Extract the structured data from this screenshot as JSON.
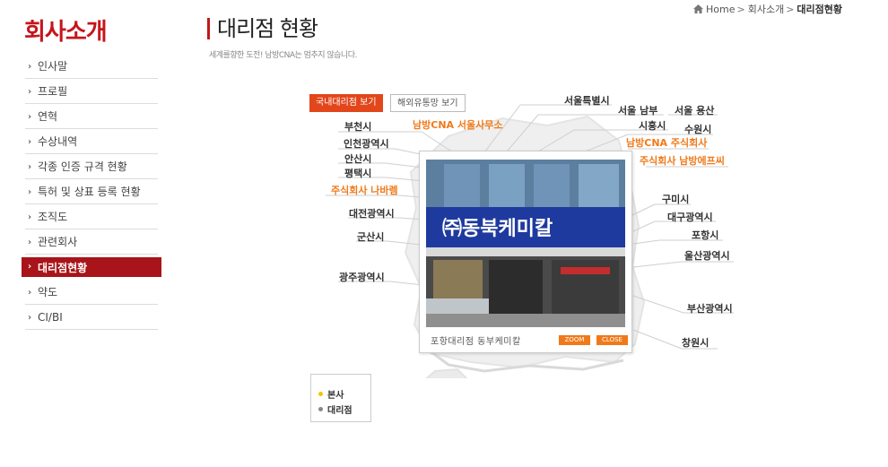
{
  "breadcrumb": {
    "home": "Home",
    "section": "회사소개",
    "current": "대리점현황"
  },
  "section_title": "회사소개",
  "sidebar": {
    "items": [
      {
        "label": "인사말"
      },
      {
        "label": "프로필"
      },
      {
        "label": "연혁"
      },
      {
        "label": "수상내역"
      },
      {
        "label": "각종 인증 규격 현황"
      },
      {
        "label": "특허 및 상표 등록 현황"
      },
      {
        "label": "조직도"
      },
      {
        "label": "관련회사"
      },
      {
        "label": "대리점현황"
      },
      {
        "label": "약도"
      },
      {
        "label": "CI/BI"
      }
    ],
    "active_label": "대리점현황"
  },
  "page": {
    "title": "대리점 현황",
    "subtitle": "세계를향한 도전! 남방CNA는 멈추지 않습니다."
  },
  "tabs": {
    "domestic": "국내대리점 보기",
    "overseas": "해외유통망 보기"
  },
  "cities": {
    "seoul": "서울특별시",
    "seoul_south": "서울 남부",
    "seoul_yongsan": "서울 용산",
    "bucheon": "부천시",
    "hq_seoul_office": "남방CNA 서울사무소",
    "siheung": "시흥시",
    "suwon": "수원시",
    "incheon": "인천광역시",
    "hq_company": "남방CNA 주식회사",
    "ansan": "안산시",
    "namhang_ftc": "주식회사 남방에프씨",
    "pyeongtaek": "평택시",
    "nabarem": "주식회사 나바렘",
    "gumi": "구미시",
    "daejeon": "대전광역시",
    "daegu": "대구광역시",
    "gunsan": "군산시",
    "pohang": "포항시",
    "ulsan": "울산광역시",
    "gwangju": "광주광역시",
    "busan": "부산광역시",
    "changwon": "창원시"
  },
  "photo": {
    "sign_text": "㈜동북케미칼",
    "caption": "포항대리점 동부케미칼",
    "zoom_label": "ZOOM",
    "close_label": "CLOSE"
  },
  "legend": {
    "hq": "본사",
    "agency": "대리점",
    "hq_color": "#f5c400",
    "agency_color": "#888888"
  },
  "colors": {
    "brand_red": "#c4161c",
    "accent_orange": "#f07a1a",
    "active_red": "#a8141a"
  }
}
